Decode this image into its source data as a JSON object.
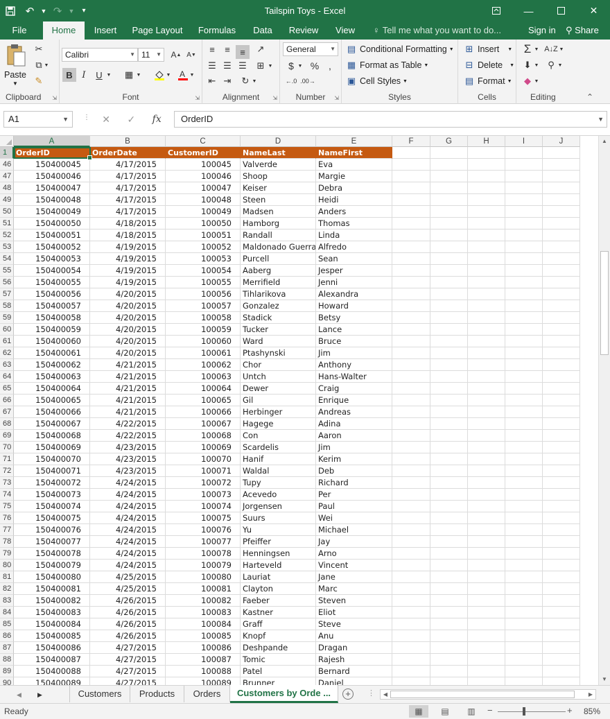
{
  "window": {
    "title": "Tailspin Toys - Excel",
    "icons": {
      "save": "save-icon",
      "undo": "undo-icon",
      "redo": "redo-icon",
      "customize": "customize-qat-icon",
      "ribbon_display": "ribbon-display-options-icon",
      "minimize": "minimize-icon",
      "maximize": "maximize-icon",
      "close": "close-icon"
    }
  },
  "tabs": [
    {
      "label": "File",
      "active": false
    },
    {
      "label": "Home",
      "active": true
    },
    {
      "label": "Insert",
      "active": false
    },
    {
      "label": "Page Layout",
      "active": false
    },
    {
      "label": "Formulas",
      "active": false
    },
    {
      "label": "Data",
      "active": false
    },
    {
      "label": "Review",
      "active": false
    },
    {
      "label": "View",
      "active": false
    }
  ],
  "tellme": {
    "text": "Tell me what you want to do..."
  },
  "account": {
    "signin": "Sign in",
    "share": "Share"
  },
  "ribbon": {
    "clipboard": {
      "label": "Clipboard",
      "paste": "Paste"
    },
    "font": {
      "label": "Font",
      "family": "Calibri",
      "size": "11",
      "bold": "B",
      "italic": "I",
      "underline": "U"
    },
    "alignment": {
      "label": "Alignment"
    },
    "number": {
      "label": "Number",
      "format": "General",
      "currency": "$",
      "percent": "%"
    },
    "styles": {
      "label": "Styles",
      "conditional": "Conditional Formatting",
      "format_table": "Format as Table",
      "cell_styles": "Cell Styles"
    },
    "cells": {
      "label": "Cells",
      "insert": "Insert",
      "delete": "Delete",
      "format": "Format"
    },
    "editing": {
      "label": "Editing"
    }
  },
  "formula_bar": {
    "name_box": "A1",
    "content": "OrderID",
    "fx": "fx"
  },
  "columns": [
    "A",
    "B",
    "C",
    "D",
    "E",
    "F",
    "G",
    "H",
    "I",
    "J"
  ],
  "header_row": {
    "num": "1",
    "cells": [
      "OrderID",
      "OrderDate",
      "CustomerID",
      "NameLast",
      "NameFirst"
    ]
  },
  "rows": [
    {
      "num": "46",
      "order_id": "150400045",
      "date": "4/17/2015",
      "customer_id": "100045",
      "last": "Valverde",
      "first": "Eva"
    },
    {
      "num": "47",
      "order_id": "150400046",
      "date": "4/17/2015",
      "customer_id": "100046",
      "last": "Shoop",
      "first": "Margie"
    },
    {
      "num": "48",
      "order_id": "150400047",
      "date": "4/17/2015",
      "customer_id": "100047",
      "last": "Keiser",
      "first": "Debra"
    },
    {
      "num": "49",
      "order_id": "150400048",
      "date": "4/17/2015",
      "customer_id": "100048",
      "last": "Steen",
      "first": "Heidi"
    },
    {
      "num": "50",
      "order_id": "150400049",
      "date": "4/17/2015",
      "customer_id": "100049",
      "last": "Madsen",
      "first": "Anders"
    },
    {
      "num": "51",
      "order_id": "150400050",
      "date": "4/18/2015",
      "customer_id": "100050",
      "last": "Hamborg",
      "first": "Thomas"
    },
    {
      "num": "52",
      "order_id": "150400051",
      "date": "4/18/2015",
      "customer_id": "100051",
      "last": "Randall",
      "first": "Linda"
    },
    {
      "num": "53",
      "order_id": "150400052",
      "date": "4/19/2015",
      "customer_id": "100052",
      "last": "Maldonado Guerra",
      "first": "Alfredo"
    },
    {
      "num": "54",
      "order_id": "150400053",
      "date": "4/19/2015",
      "customer_id": "100053",
      "last": "Purcell",
      "first": "Sean"
    },
    {
      "num": "55",
      "order_id": "150400054",
      "date": "4/19/2015",
      "customer_id": "100054",
      "last": "Aaberg",
      "first": "Jesper"
    },
    {
      "num": "56",
      "order_id": "150400055",
      "date": "4/19/2015",
      "customer_id": "100055",
      "last": "Merrifield",
      "first": "Jenni"
    },
    {
      "num": "57",
      "order_id": "150400056",
      "date": "4/20/2015",
      "customer_id": "100056",
      "last": "Tihlarikova",
      "first": "Alexandra"
    },
    {
      "num": "58",
      "order_id": "150400057",
      "date": "4/20/2015",
      "customer_id": "100057",
      "last": "Gonzalez",
      "first": "Howard"
    },
    {
      "num": "59",
      "order_id": "150400058",
      "date": "4/20/2015",
      "customer_id": "100058",
      "last": "Stadick",
      "first": "Betsy"
    },
    {
      "num": "60",
      "order_id": "150400059",
      "date": "4/20/2015",
      "customer_id": "100059",
      "last": "Tucker",
      "first": "Lance"
    },
    {
      "num": "61",
      "order_id": "150400060",
      "date": "4/20/2015",
      "customer_id": "100060",
      "last": "Ward",
      "first": "Bruce"
    },
    {
      "num": "62",
      "order_id": "150400061",
      "date": "4/20/2015",
      "customer_id": "100061",
      "last": "Ptashynski",
      "first": "Jim"
    },
    {
      "num": "63",
      "order_id": "150400062",
      "date": "4/21/2015",
      "customer_id": "100062",
      "last": "Chor",
      "first": "Anthony"
    },
    {
      "num": "64",
      "order_id": "150400063",
      "date": "4/21/2015",
      "customer_id": "100063",
      "last": "Untch",
      "first": "Hans-Walter"
    },
    {
      "num": "65",
      "order_id": "150400064",
      "date": "4/21/2015",
      "customer_id": "100064",
      "last": "Dewer",
      "first": "Craig"
    },
    {
      "num": "66",
      "order_id": "150400065",
      "date": "4/21/2015",
      "customer_id": "100065",
      "last": "Gil",
      "first": "Enrique"
    },
    {
      "num": "67",
      "order_id": "150400066",
      "date": "4/21/2015",
      "customer_id": "100066",
      "last": "Herbinger",
      "first": "Andreas"
    },
    {
      "num": "68",
      "order_id": "150400067",
      "date": "4/22/2015",
      "customer_id": "100067",
      "last": "Hagege",
      "first": "Adina"
    },
    {
      "num": "69",
      "order_id": "150400068",
      "date": "4/22/2015",
      "customer_id": "100068",
      "last": "Con",
      "first": "Aaron"
    },
    {
      "num": "70",
      "order_id": "150400069",
      "date": "4/23/2015",
      "customer_id": "100069",
      "last": "Scardelis",
      "first": "Jim"
    },
    {
      "num": "71",
      "order_id": "150400070",
      "date": "4/23/2015",
      "customer_id": "100070",
      "last": "Hanif",
      "first": "Kerim"
    },
    {
      "num": "72",
      "order_id": "150400071",
      "date": "4/23/2015",
      "customer_id": "100071",
      "last": "Waldal",
      "first": "Deb"
    },
    {
      "num": "73",
      "order_id": "150400072",
      "date": "4/24/2015",
      "customer_id": "100072",
      "last": "Tupy",
      "first": "Richard"
    },
    {
      "num": "74",
      "order_id": "150400073",
      "date": "4/24/2015",
      "customer_id": "100073",
      "last": "Acevedo",
      "first": "Per"
    },
    {
      "num": "75",
      "order_id": "150400074",
      "date": "4/24/2015",
      "customer_id": "100074",
      "last": "Jorgensen",
      "first": "Paul"
    },
    {
      "num": "76",
      "order_id": "150400075",
      "date": "4/24/2015",
      "customer_id": "100075",
      "last": "Suurs",
      "first": "Wei"
    },
    {
      "num": "77",
      "order_id": "150400076",
      "date": "4/24/2015",
      "customer_id": "100076",
      "last": "Yu",
      "first": "Michael"
    },
    {
      "num": "78",
      "order_id": "150400077",
      "date": "4/24/2015",
      "customer_id": "100077",
      "last": "Pfeiffer",
      "first": "Jay"
    },
    {
      "num": "79",
      "order_id": "150400078",
      "date": "4/24/2015",
      "customer_id": "100078",
      "last": "Henningsen",
      "first": "Arno"
    },
    {
      "num": "80",
      "order_id": "150400079",
      "date": "4/24/2015",
      "customer_id": "100079",
      "last": "Harteveld",
      "first": "Vincent"
    },
    {
      "num": "81",
      "order_id": "150400080",
      "date": "4/25/2015",
      "customer_id": "100080",
      "last": "Lauriat",
      "first": "Jane"
    },
    {
      "num": "82",
      "order_id": "150400081",
      "date": "4/25/2015",
      "customer_id": "100081",
      "last": "Clayton",
      "first": "Marc"
    },
    {
      "num": "83",
      "order_id": "150400082",
      "date": "4/26/2015",
      "customer_id": "100082",
      "last": "Faeber",
      "first": "Steven"
    },
    {
      "num": "84",
      "order_id": "150400083",
      "date": "4/26/2015",
      "customer_id": "100083",
      "last": "Kastner",
      "first": "Eliot"
    },
    {
      "num": "85",
      "order_id": "150400084",
      "date": "4/26/2015",
      "customer_id": "100084",
      "last": "Graff",
      "first": "Steve"
    },
    {
      "num": "86",
      "order_id": "150400085",
      "date": "4/26/2015",
      "customer_id": "100085",
      "last": "Knopf",
      "first": "Anu"
    },
    {
      "num": "87",
      "order_id": "150400086",
      "date": "4/27/2015",
      "customer_id": "100086",
      "last": "Deshpande",
      "first": "Dragan"
    },
    {
      "num": "88",
      "order_id": "150400087",
      "date": "4/27/2015",
      "customer_id": "100087",
      "last": "Tomic",
      "first": "Rajesh"
    },
    {
      "num": "89",
      "order_id": "150400088",
      "date": "4/27/2015",
      "customer_id": "100088",
      "last": "Patel",
      "first": "Bernard"
    },
    {
      "num": "90",
      "order_id": "150400089",
      "date": "4/27/2015",
      "customer_id": "100089",
      "last": "Brunner",
      "first": "Daniel"
    }
  ],
  "sheets": [
    {
      "label": "Customers",
      "active": false
    },
    {
      "label": "Products",
      "active": false
    },
    {
      "label": "Orders",
      "active": false
    },
    {
      "label": "Customers by Orde ...",
      "active": true
    }
  ],
  "status": {
    "ready": "Ready",
    "zoom": "85%"
  },
  "colors": {
    "excel_green": "#217346",
    "header_fill": "#c55a11"
  }
}
